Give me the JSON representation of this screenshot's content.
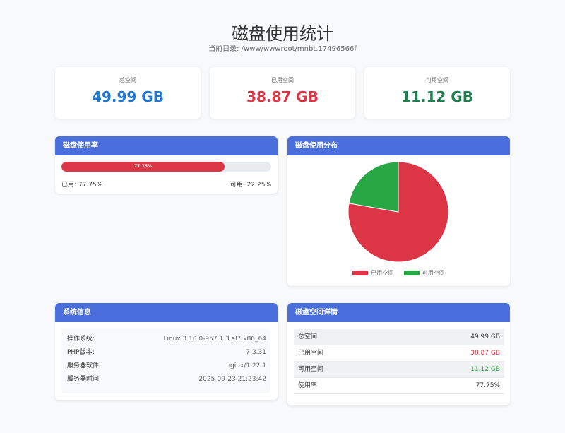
{
  "header": {
    "title": "磁盘使用统计",
    "subtitle": "当前目录: /www/wwwroot/mnbt.17496566f"
  },
  "stats": [
    {
      "label": "总空间",
      "value": "49.99 GB",
      "color": "#1f78d1"
    },
    {
      "label": "已用空间",
      "value": "38.87 GB",
      "color": "#dc3545"
    },
    {
      "label": "可用空间",
      "value": "11.12 GB",
      "color": "#1e7e4f"
    }
  ],
  "usage_panel": {
    "title": "磁盘使用率",
    "percent": 77.75,
    "percent_label": "77.75%",
    "used_text": "已用: 77.75%",
    "free_text": "可用: 22.25%",
    "bar_color": "#dc3545"
  },
  "chart_data": {
    "type": "pie",
    "title": "磁盘使用分布",
    "categories": [
      "已用空间",
      "可用空间"
    ],
    "values": [
      77.75,
      22.25
    ],
    "colors": [
      "#dc3545",
      "#28a745"
    ],
    "legend_position": "bottom"
  },
  "system_panel": {
    "title": "系统信息",
    "rows": [
      {
        "label": "操作系统:",
        "value": "Linux 3.10.0-957.1.3.el7.x86_64"
      },
      {
        "label": "PHP版本:",
        "value": "7.3.31"
      },
      {
        "label": "服务器软件:",
        "value": "nginx/1.22.1"
      },
      {
        "label": "服务器时间:",
        "value": "2025-09-23 21:23:42"
      }
    ]
  },
  "detail_panel": {
    "title": "磁盘空间详情",
    "rows": [
      {
        "label": "总空间",
        "value": "49.99 GB",
        "color": "#333333"
      },
      {
        "label": "已用空间",
        "value": "38.87 GB",
        "color": "#dc3545"
      },
      {
        "label": "可用空间",
        "value": "11.12 GB",
        "color": "#28a745"
      },
      {
        "label": "使用率",
        "value": "77.75%",
        "color": "#333333"
      }
    ]
  }
}
